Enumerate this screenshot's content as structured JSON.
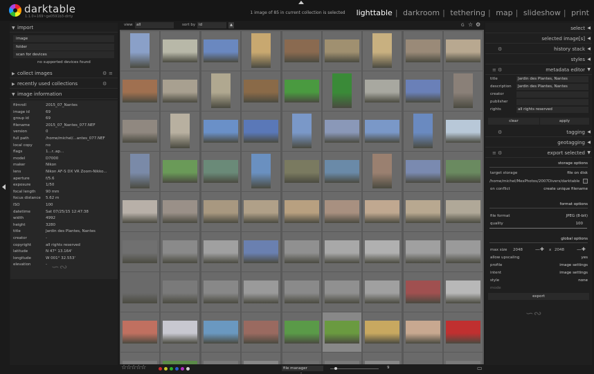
{
  "app": {
    "name": "darktable",
    "version": "1.1.0+169~ge0591b3-dirty"
  },
  "status": "1 image of 85 in current collection is selected",
  "views": [
    "lighttable",
    "darkroom",
    "tethering",
    "map",
    "slideshow",
    "print"
  ],
  "active_view": "lighttable",
  "left": {
    "import": {
      "title": "import",
      "image": "image",
      "folder": "folder",
      "scan": "scan for devices",
      "none_found": "no supported devices found"
    },
    "collect": {
      "title": "collect images"
    },
    "recent": {
      "title": "recently used collections"
    },
    "info": {
      "title": "image information",
      "rows": [
        {
          "k": "filmroll",
          "v": "2015_07_Nantes"
        },
        {
          "k": "image id",
          "v": "69"
        },
        {
          "k": "group id",
          "v": "69"
        },
        {
          "k": "filename",
          "v": "2015_07_Nantes_077.NEF"
        },
        {
          "k": "version",
          "v": "0"
        },
        {
          "k": "full path",
          "v": "/home/michel/...antes_077.NEF"
        },
        {
          "k": "local copy",
          "v": "no"
        },
        {
          "k": "flags",
          "v": "1...r..ap..."
        },
        {
          "k": "model",
          "v": "D7000"
        },
        {
          "k": "maker",
          "v": "Nikon"
        },
        {
          "k": "lens",
          "v": "Nikon AF-S DX VR Zoom-Nikko..."
        },
        {
          "k": "aperture",
          "v": "f/5.6"
        },
        {
          "k": "exposure",
          "v": "1/50"
        },
        {
          "k": "focal length",
          "v": "90 mm"
        },
        {
          "k": "focus distance",
          "v": "5.62 m"
        },
        {
          "k": "ISO",
          "v": "100"
        },
        {
          "k": "datetime",
          "v": "Sat 07/25/15 12:47:38"
        },
        {
          "k": "width",
          "v": "4992"
        },
        {
          "k": "height",
          "v": "3280"
        },
        {
          "k": "title",
          "v": "Jardin des Plantes, Nantes"
        },
        {
          "k": "creator",
          "v": "-"
        },
        {
          "k": "copyright",
          "v": "all rights reserved"
        },
        {
          "k": "latitude",
          "v": "N 47° 13.164'"
        },
        {
          "k": "longitude",
          "v": "W 001° 32.553'"
        },
        {
          "k": "elevation",
          "v": "-"
        }
      ]
    }
  },
  "toolbar": {
    "view_label": "view",
    "view_value": "all",
    "sort_label": "sort by",
    "sort_value": "id",
    "g_label": "G"
  },
  "bottom": {
    "stars": "☆☆☆☆☆",
    "layout": "file manager",
    "zoom": "9"
  },
  "color_labels": [
    "#cc2a2a",
    "#c9c92a",
    "#2ab02a",
    "#2a5ccc",
    "#b030c0",
    "#cccccc"
  ],
  "right": {
    "select": "select",
    "selected": "selected image[s]",
    "history": "history stack",
    "styles": "styles",
    "metadata": {
      "title": "metadata editor",
      "fields": [
        {
          "k": "title",
          "v": "Jardin des Plantes, Nantes"
        },
        {
          "k": "description",
          "v": "Jardin des Plantes, Nantes"
        },
        {
          "k": "creator",
          "v": ""
        },
        {
          "k": "publisher",
          "v": ""
        },
        {
          "k": "rights",
          "v": "all rights reserved"
        }
      ],
      "clear": "clear",
      "apply": "apply"
    },
    "tagging": "tagging",
    "geotagging": "geotagging",
    "export": {
      "title": "export selected",
      "storage_options": "storage options",
      "target_storage_label": "target storage",
      "target_storage": "file on disk",
      "path": "/home/michel/MesPhotos/2007Divers/darktable_e",
      "on_conflict_label": "on conflict",
      "on_conflict": "create unique filename",
      "format_options": "format options",
      "file_format_label": "file format",
      "file_format": "JPEG (8-bit)",
      "quality_label": "quality",
      "quality": "100",
      "global_options": "global options",
      "max_size_label": "max size",
      "max_w": "2048",
      "x": "x",
      "max_h": "2048",
      "upscaling_label": "allow upscaling",
      "upscaling": "yes",
      "profile_label": "profile",
      "profile": "image settings",
      "intent_label": "intent",
      "intent": "image settings",
      "style_label": "style",
      "style": "none",
      "mode_label": "mode",
      "export_btn": "export"
    }
  },
  "thumb_colors": [
    [
      "#8aa0c8",
      "#b8b8a8",
      "#6a88c0",
      "#c8a870",
      "#8a6a50",
      "#a09070",
      "#c8b080",
      "#9a8a78",
      "#b8a890"
    ],
    [
      "#a07050",
      "#a8a090",
      "#b0a890",
      "#8a6a48",
      "#4a9a40",
      "#3a8a38",
      "#a8a8a0",
      "#6a80b8",
      "#8a8078"
    ],
    [
      "#908880",
      "#b8b0a0",
      "#6a90c8",
      "#5a78b8",
      "#7a98c8",
      "#8a98b8",
      "#7a98c8",
      "#6a8ac0",
      "#b8c8d8"
    ],
    [
      "#7a8aa8",
      "#6a9a58",
      "#6a8a78",
      "#6a90c0",
      "#7a7a60",
      "#6a8aa8",
      "#9a8070",
      "#7a8ab0",
      "#6a8a60"
    ],
    [
      "#b8b0a8",
      "#9a9088",
      "#a89880",
      "#b0a088",
      "#b8a080",
      "#a89080",
      "#c0a890",
      "#b8a890",
      "#b0a898"
    ],
    [
      "#707070",
      "#8a8a8a",
      "#a0a0a0",
      "#6a80b0",
      "#909090",
      "#a8a8a8",
      "#b0b0b0",
      "#a0a0a0",
      "#9a9a9a"
    ],
    [
      "#6a6a6a",
      "#7a7a7a",
      "#888888",
      "#9a9a9a",
      "#8a8a8a",
      "#909090",
      "#a0a0a0",
      "#a05050",
      "#b8b8b8"
    ],
    [
      "#c07060",
      "#c8c8d0",
      "#6a98c0",
      "#9a6a60",
      "#5a9a48",
      "#6a9a40",
      "#c8a860",
      "#c8a890",
      "#c03030"
    ],
    [
      "#7a7a7a",
      "#5a8a48",
      "#7a7a7a",
      "#888888",
      "#707070",
      "#7a7a7a",
      "#888888",
      "#6a6a6a",
      "#7a7a7a"
    ]
  ]
}
